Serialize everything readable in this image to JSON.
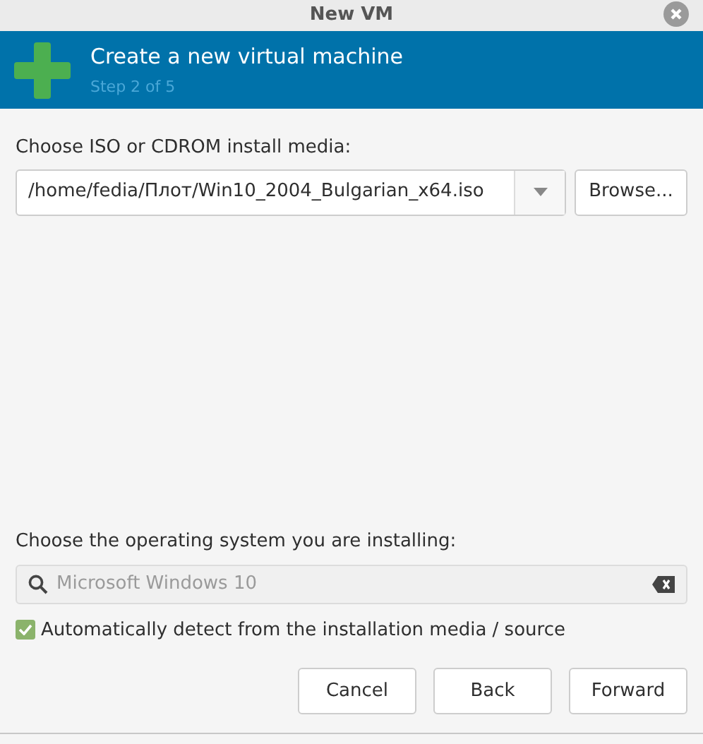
{
  "window": {
    "title": "New VM"
  },
  "header": {
    "title": "Create a new virtual machine",
    "subtitle": "Step 2 of 5"
  },
  "media": {
    "label": "Choose ISO or CDROM install media:",
    "value": "/home/fedia/Плот/Win10_2004_Bulgarian_x64.iso",
    "browse": "Browse..."
  },
  "os": {
    "label": "Choose the operating system you are installing:",
    "value": "Microsoft Windows 10",
    "disabled": true
  },
  "autodetect": {
    "label": "Automatically detect from the installation media / source",
    "checked": true
  },
  "buttons": [
    "Cancel",
    "Back",
    "Forward"
  ]
}
